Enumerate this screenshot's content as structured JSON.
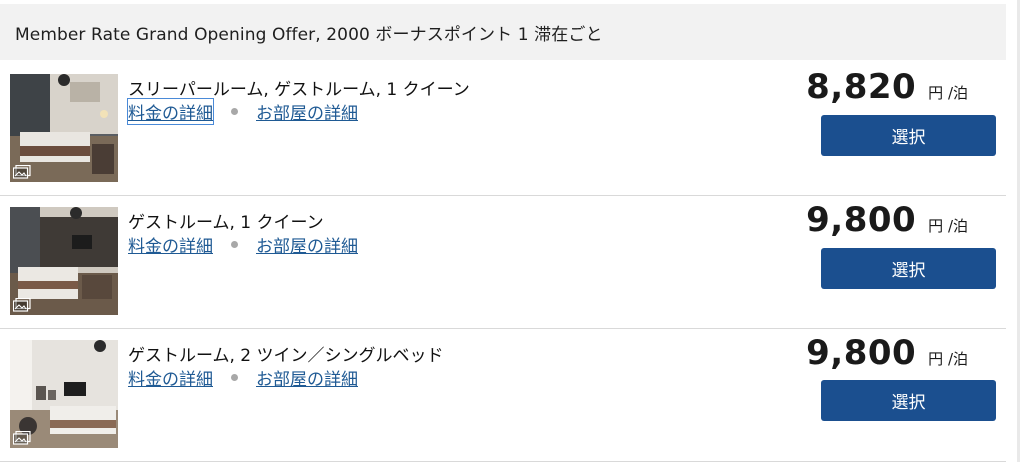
{
  "rate_plan": {
    "title": "Member Rate Grand Opening Offer, 2000 ボーナスポイント 1 滞在ごと"
  },
  "rooms": [
    {
      "name": "スリーパールーム, ゲストルーム, 1 クイーン",
      "rate_details_label": "料金の詳細",
      "room_details_label": "お部屋の詳細",
      "price": "8,820",
      "price_unit": "円 /泊",
      "select_label": "選択"
    },
    {
      "name": "ゲストルーム, 1 クイーン",
      "rate_details_label": "料金の詳細",
      "room_details_label": "お部屋の詳細",
      "price": "9,800",
      "price_unit": "円 /泊",
      "select_label": "選択"
    },
    {
      "name": "ゲストルーム, 2 ツイン／シングルベッド",
      "rate_details_label": "料金の詳細",
      "room_details_label": "お部屋の詳細",
      "price": "9,800",
      "price_unit": "円 /泊",
      "select_label": "選択"
    }
  ],
  "icons": {
    "gallery": "photo-gallery-icon",
    "separator": "dot-separator"
  },
  "colors": {
    "button_bg": "#1b4f8f",
    "link": "#1f5a94",
    "header_bg": "#f2f2f2"
  }
}
